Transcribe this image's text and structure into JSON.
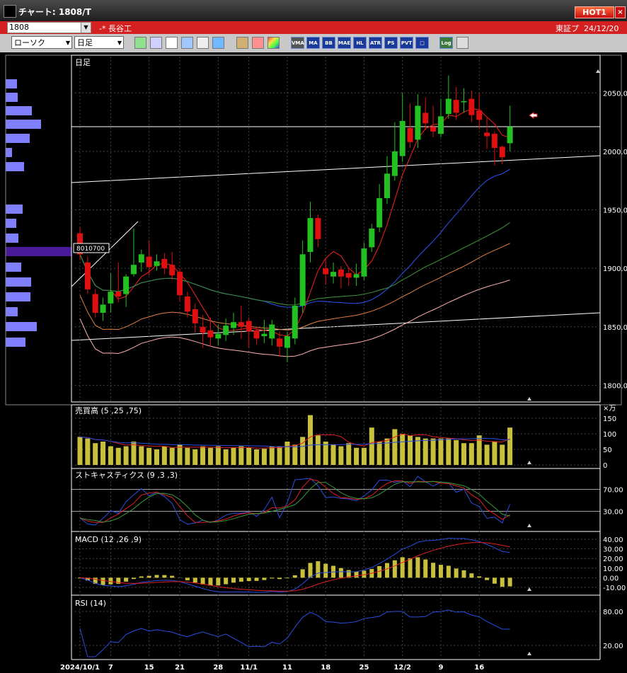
{
  "window": {
    "title": "チャート: 1808/T",
    "hot_button": "HOT1",
    "close_button": "×"
  },
  "stock_bar": {
    "code": "1808",
    "name": "-* 長谷工",
    "exchange": "東証プ",
    "date": "24/12/20"
  },
  "toolbar": {
    "chart_type": "ローソク",
    "period": "日足",
    "tools": [
      "pen-tool",
      "draw-tool",
      "cursor-tool",
      "flip-tool",
      "table-tool",
      "clipboard-tool",
      "pattern-tool",
      "brush-tool",
      "color-tool"
    ],
    "indicator_buttons": [
      "VMA",
      "MA",
      "BB",
      "MAE",
      "HL",
      "ATR",
      "PS",
      "PVT",
      "□",
      "Log",
      "clear"
    ]
  },
  "colors": {
    "up": "#22c020",
    "down": "#e01010",
    "panel_border": "#ffffff",
    "volume": "#c8c03c",
    "text": "#ffffff"
  },
  "price_panel": {
    "label": "日足",
    "axis_ticks": [
      "2050.0",
      "2000.0",
      "1950.0",
      "1900.0",
      "1850.0",
      "1800.0"
    ],
    "volume_profile_marker": "8010700",
    "dates": [
      "2024/10/1",
      "7",
      "15",
      "21",
      "28",
      "11/1",
      "11",
      "18",
      "25",
      "12/2",
      "9",
      "16"
    ]
  },
  "volume_panel": {
    "label": "売買高 (5 ,25 ,75)",
    "unit": "×万",
    "axis_ticks": [
      "150",
      "100",
      "50",
      "0"
    ]
  },
  "stoch_panel": {
    "label": "ストキャスティクス (9 ,3 ,3)",
    "axis_ticks": [
      "70.00",
      "30.00"
    ]
  },
  "macd_panel": {
    "label": "MACD (12 ,26 ,9)",
    "axis_ticks": [
      "40.00",
      "30.00",
      "20.00",
      "10.00",
      "0.00",
      "-10.00"
    ]
  },
  "rsi_panel": {
    "label": "RSI (14)",
    "axis_ticks": [
      "80.00",
      "20.00"
    ]
  },
  "chart_data": {
    "type": "candlestick",
    "dates": [
      "10/1",
      "10/2",
      "10/3",
      "10/4",
      "10/7",
      "10/8",
      "10/9",
      "10/10",
      "10/11",
      "10/15",
      "10/16",
      "10/17",
      "10/18",
      "10/21",
      "10/22",
      "10/23",
      "10/24",
      "10/25",
      "10/28",
      "10/29",
      "10/30",
      "10/31",
      "11/1",
      "11/5",
      "11/6",
      "11/7",
      "11/8",
      "11/11",
      "11/12",
      "11/13",
      "11/14",
      "11/15",
      "11/18",
      "11/19",
      "11/20",
      "11/21",
      "11/22",
      "11/25",
      "11/26",
      "11/27",
      "11/28",
      "11/29",
      "12/2",
      "12/3",
      "12/4",
      "12/5",
      "12/6",
      "12/9",
      "12/10",
      "12/11",
      "12/12",
      "12/13",
      "12/16",
      "12/17",
      "12/18",
      "12/19",
      "12/20"
    ],
    "open": [
      1930,
      1905,
      1878,
      1862,
      1870,
      1880,
      1878,
      1895,
      1905,
      1910,
      1902,
      1908,
      1903,
      1897,
      1876,
      1865,
      1850,
      1847,
      1840,
      1843,
      1849,
      1854,
      1855,
      1847,
      1842,
      1840,
      1840,
      1832,
      1840,
      1868,
      1914,
      1943,
      1900,
      1893,
      1899,
      1896,
      1892,
      1893,
      1918,
      1935,
      1960,
      1979,
      1996,
      2020,
      2010,
      2033,
      2021,
      2015,
      2032,
      2044,
      2042,
      2045,
      2035,
      2016,
      2015,
      2004,
      2007
    ],
    "close": [
      1912,
      1882,
      1862,
      1869,
      1880,
      1876,
      1893,
      1903,
      1912,
      1901,
      1906,
      1900,
      1894,
      1877,
      1863,
      1853,
      1845,
      1841,
      1844,
      1851,
      1854,
      1850,
      1846,
      1840,
      1844,
      1852,
      1833,
      1842,
      1868,
      1912,
      1943,
      1925,
      1895,
      1897,
      1893,
      1892,
      1895,
      1917,
      1934,
      1960,
      1981,
      2000,
      2026,
      2008,
      2039,
      2024,
      2017,
      2030,
      2045,
      2033,
      2043,
      2031,
      2027,
      2013,
      2003,
      1995,
      2021
    ],
    "high": [
      1935,
      1910,
      1882,
      1875,
      1896,
      1905,
      1895,
      1934,
      1916,
      1924,
      1912,
      1913,
      1914,
      1900,
      1880,
      1870,
      1860,
      1858,
      1852,
      1857,
      1862,
      1868,
      1858,
      1850,
      1856,
      1856,
      1846,
      1846,
      1875,
      1924,
      1957,
      1946,
      1908,
      1905,
      1902,
      1901,
      1904,
      1922,
      1938,
      1972,
      1996,
      2025,
      2050,
      2041,
      2049,
      2046,
      2039,
      2045,
      2065,
      2055,
      2054,
      2052,
      2050,
      2029,
      2017,
      2005,
      2039
    ],
    "low": [
      1907,
      1878,
      1858,
      1855,
      1862,
      1871,
      1867,
      1893,
      1897,
      1894,
      1898,
      1895,
      1890,
      1872,
      1858,
      1845,
      1832,
      1833,
      1834,
      1838,
      1843,
      1840,
      1832,
      1835,
      1836,
      1834,
      1825,
      1820,
      1835,
      1862,
      1905,
      1918,
      1886,
      1887,
      1883,
      1885,
      1885,
      1890,
      1914,
      1931,
      1955,
      1975,
      1991,
      2003,
      2003,
      2018,
      2012,
      2012,
      2028,
      2027,
      2033,
      2025,
      2019,
      2002,
      1988,
      1989,
      2000
    ],
    "volume": [
      90,
      85,
      70,
      75,
      60,
      55,
      60,
      75,
      60,
      55,
      50,
      60,
      55,
      65,
      55,
      50,
      60,
      55,
      60,
      50,
      55,
      60,
      55,
      50,
      52,
      60,
      60,
      75,
      65,
      90,
      160,
      95,
      75,
      65,
      60,
      70,
      55,
      55,
      120,
      75,
      85,
      115,
      100,
      95,
      90,
      85,
      85,
      85,
      85,
      80,
      70,
      70,
      95,
      65,
      75,
      65,
      120
    ],
    "ylim": [
      1793,
      2075
    ],
    "series": [
      {
        "name": "MA5",
        "color": "#e02020"
      },
      {
        "name": "MA25",
        "color": "#2a4ee0"
      },
      {
        "name": "MA75",
        "color": "#3a8a3a"
      }
    ]
  }
}
